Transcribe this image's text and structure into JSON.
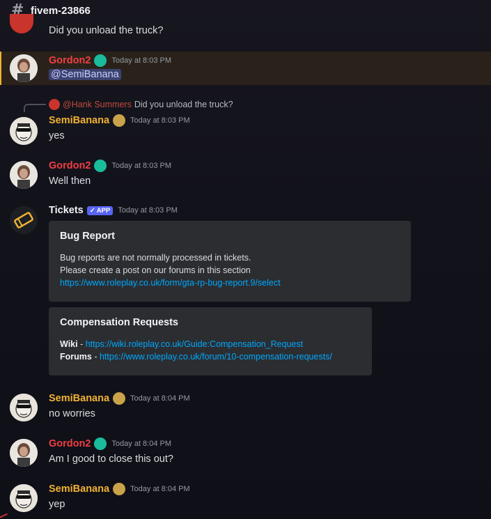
{
  "channel": {
    "name": "fivem-23866",
    "icon": "hash-icon"
  },
  "messages": {
    "m0": {
      "text": "Did you unload the truck?"
    },
    "m1": {
      "username": "Gordon2",
      "timestamp": "Today at 8:03 PM",
      "mention": "@SemiBanana"
    },
    "m2": {
      "reply_to_name": "@Hank Summers",
      "reply_to_text": "Did you unload the truck?",
      "username": "SemiBanana",
      "timestamp": "Today at 8:03 PM",
      "text": "yes"
    },
    "m3": {
      "username": "Gordon2",
      "timestamp": "Today at 8:03 PM",
      "text": "Well then"
    },
    "m4": {
      "username": "Tickets",
      "app_tag": "APP",
      "timestamp": "Today at 8:03 PM",
      "embed1": {
        "title": "Bug Report",
        "line1": "Bug reports are not normally processed in tickets.",
        "line2": "Please create a post on our forums in this section",
        "link": "https://www.roleplay.co.uk/form/gta-rp-bug-report.9/select"
      },
      "embed2": {
        "title": "Compensation Requests",
        "wiki_label": "Wiki",
        "wiki_sep": " - ",
        "wiki_link": "https://wiki.roleplay.co.uk/Guide:Compensation_Request",
        "forums_label": "Forums",
        "forums_sep": " - ",
        "forums_link": "https://www.roleplay.co.uk/forum/10-compensation-requests/"
      }
    },
    "m5": {
      "username": "SemiBanana",
      "timestamp": "Today at 8:04 PM",
      "text": "no worries"
    },
    "m6": {
      "username": "Gordon2",
      "timestamp": "Today at 8:04 PM",
      "text": "Am I good to close this out?"
    },
    "m7": {
      "username": "SemiBanana",
      "timestamp": "Today at 8:04 PM",
      "text": "yep"
    }
  },
  "colors": {
    "gordon": "#f23f43",
    "semibanana": "#f0b232",
    "link": "#00a8fc",
    "app_tag": "#5865f2",
    "embed_bg": "#2b2d31"
  }
}
